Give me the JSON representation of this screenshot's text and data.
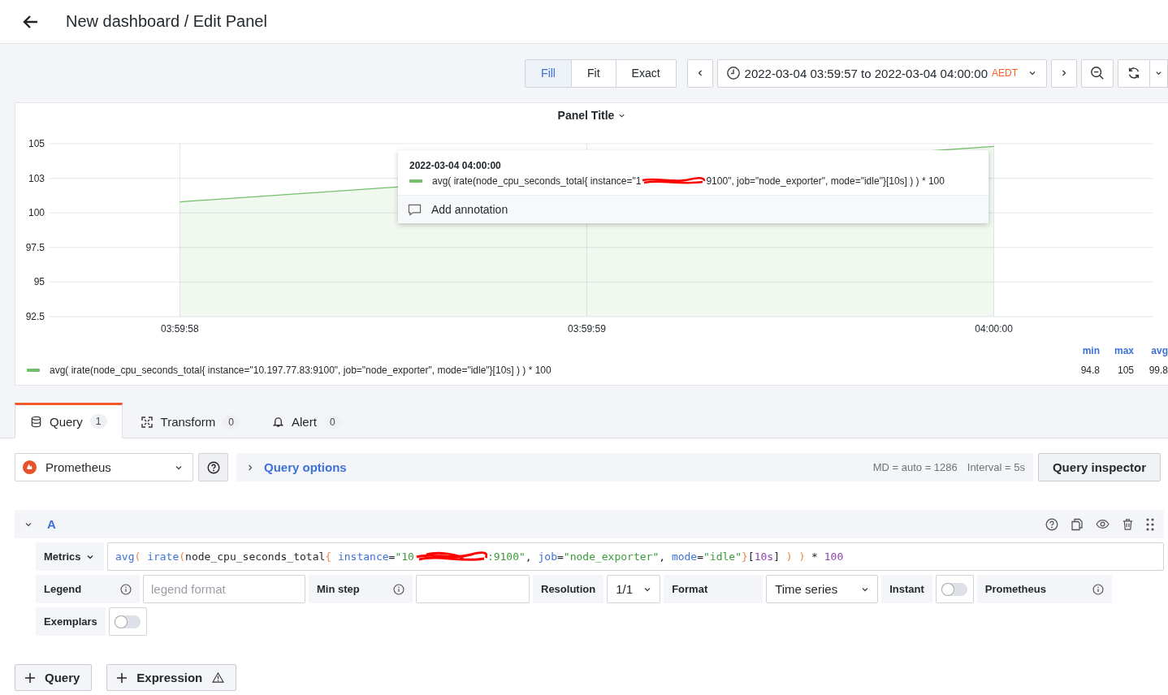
{
  "header": {
    "title": "New dashboard / Edit Panel"
  },
  "toolbar": {
    "modes": [
      {
        "label": "Fill",
        "selected": true
      },
      {
        "label": "Fit",
        "selected": false
      },
      {
        "label": "Exact",
        "selected": false
      }
    ],
    "time_range": {
      "text": "2022-03-04 03:59:57 to 2022-03-04 04:00:00",
      "timezone": "AEDT"
    }
  },
  "panel": {
    "title": "Panel Title",
    "chart_data": {
      "type": "area",
      "grid": true,
      "categories": [
        "03:59:58",
        "03:59:59",
        "04:00:00"
      ],
      "series": [
        {
          "name": "avg( irate(node_cpu_seconds_total{ instance=\"10.197.77.83:9100\", job=\"node_exporter\", mode=\"idle\"}[10s] ) ) * 100",
          "color": "#73bf69",
          "values": [
            100.8,
            null,
            104.8
          ]
        }
      ],
      "ylim": [
        92.5,
        105
      ],
      "yticks": [
        {
          "value": 92.5,
          "label": "92.5"
        },
        {
          "value": 95,
          "label": "95"
        },
        {
          "value": 97.5,
          "label": "97.5"
        },
        {
          "value": 100,
          "label": "100"
        },
        {
          "value": 102.5,
          "label": "103"
        },
        {
          "value": 105,
          "label": "105"
        }
      ]
    },
    "tooltip": {
      "time": "2022-03-04 04:00:00",
      "label_start": "avg( irate(node_cpu_seconds_total{ instance=\"1",
      "label_end": "9100\", job=\"node_exporter\", mode=\"idle\"}[10s] ) ) * 100",
      "action": "Add annotation"
    },
    "legend": {
      "columns": [
        "min",
        "max",
        "avg"
      ],
      "items": [
        {
          "stats": [
            "94.8",
            "105",
            "99.8"
          ]
        }
      ]
    }
  },
  "tabs": [
    {
      "label": "Query",
      "count": "1",
      "selected": true,
      "kind": "query"
    },
    {
      "label": "Transform",
      "count": "0",
      "selected": false,
      "kind": "transform"
    },
    {
      "label": "Alert",
      "count": "0",
      "selected": false,
      "kind": "alert"
    }
  ],
  "datasource": {
    "name": "Prometheus"
  },
  "query_options": {
    "label": "Query options",
    "expanded": false,
    "md": "MD = auto = 1286",
    "interval": "Interval = 5s",
    "inspector": "Query inspector"
  },
  "query": {
    "ref": "A",
    "expanded": true,
    "metrics_label": "Metrics",
    "tokens": [
      {
        "kind": "func",
        "text": "avg"
      },
      {
        "kind": "paren",
        "text": "( "
      },
      {
        "kind": "func",
        "text": "irate"
      },
      {
        "kind": "paren",
        "text": "("
      },
      {
        "kind": "plain",
        "text": "node_cpu_seconds_total"
      },
      {
        "kind": "paren",
        "text": "{ "
      },
      {
        "kind": "label",
        "text": "instance"
      },
      {
        "kind": "plain",
        "text": "="
      },
      {
        "kind": "string",
        "text": "\"10"
      },
      {
        "kind": "redacted"
      },
      {
        "kind": "string",
        "text": ":9100\""
      },
      {
        "kind": "plain",
        "text": ", "
      },
      {
        "kind": "label",
        "text": "job"
      },
      {
        "kind": "plain",
        "text": "="
      },
      {
        "kind": "string",
        "text": "\"node_exporter\""
      },
      {
        "kind": "plain",
        "text": ", "
      },
      {
        "kind": "label",
        "text": "mode"
      },
      {
        "kind": "plain",
        "text": "="
      },
      {
        "kind": "string",
        "text": "\"idle\""
      },
      {
        "kind": "paren",
        "text": "}"
      },
      {
        "kind": "plain",
        "text": "["
      },
      {
        "kind": "number",
        "text": "10s"
      },
      {
        "kind": "plain",
        "text": "] "
      },
      {
        "kind": "paren",
        "text": ") "
      },
      {
        "kind": "paren",
        "text": ")"
      },
      {
        "kind": "plain",
        "text": " * "
      },
      {
        "kind": "number",
        "text": "100"
      }
    ],
    "legend_label": "Legend",
    "legend_placeholder": "legend format",
    "min_step_label": "Min step",
    "resolution_label": "Resolution",
    "resolution": "1/1",
    "format_label": "Format",
    "format": "Time series",
    "instant_label": "Instant",
    "instant_on": false,
    "source_label": "Prometheus",
    "exemplars_label": "Exemplars",
    "exemplars_on": false
  },
  "actions": [
    {
      "label": "Query",
      "warning": false
    },
    {
      "label": "Expression",
      "warning": true
    }
  ]
}
